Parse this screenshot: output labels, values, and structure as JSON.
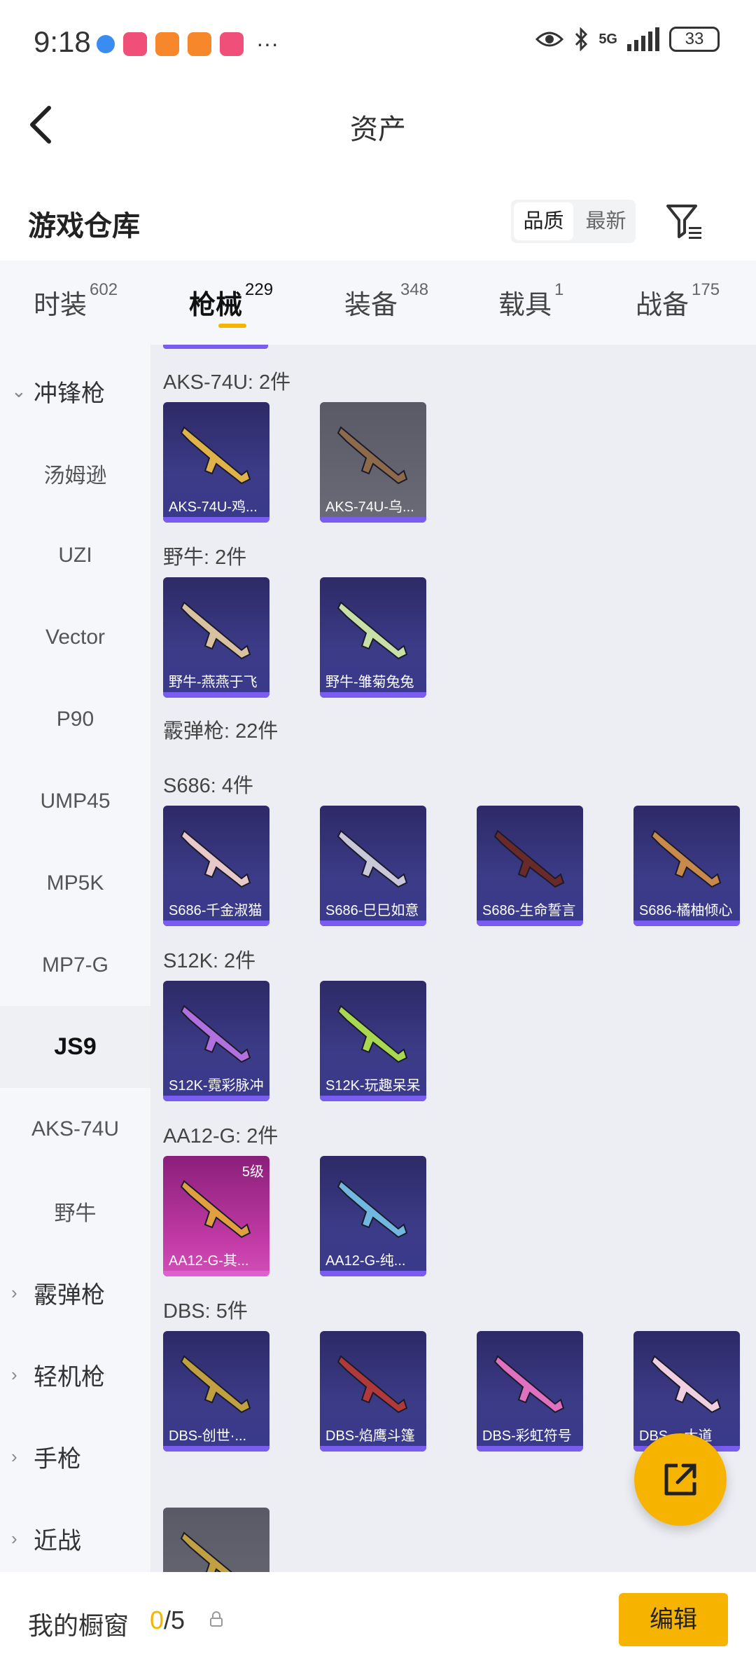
{
  "status_bar": {
    "time": "9:18",
    "network": "5G",
    "battery": "33"
  },
  "header": {
    "title": "资产"
  },
  "section": {
    "title": "游戏仓库",
    "sort_options": [
      "品质",
      "最新"
    ]
  },
  "tabs": [
    {
      "label": "时装",
      "count": "602"
    },
    {
      "label": "枪械",
      "count": "229"
    },
    {
      "label": "装备",
      "count": "348"
    },
    {
      "label": "载具",
      "count": "1"
    },
    {
      "label": "战备",
      "count": "175"
    }
  ],
  "sidebar": {
    "items": [
      {
        "label": "冲锋枪",
        "type": "group",
        "chevron": "⌄"
      },
      {
        "label": "汤姆逊",
        "type": "item"
      },
      {
        "label": "UZI",
        "type": "item"
      },
      {
        "label": "Vector",
        "type": "item"
      },
      {
        "label": "P90",
        "type": "item"
      },
      {
        "label": "UMP45",
        "type": "item"
      },
      {
        "label": "MP5K",
        "type": "item"
      },
      {
        "label": "MP7-G",
        "type": "item"
      },
      {
        "label": "JS9",
        "type": "item",
        "active": true
      },
      {
        "label": "AKS-74U",
        "type": "item"
      },
      {
        "label": "野牛",
        "type": "item"
      },
      {
        "label": "霰弹枪",
        "type": "group",
        "chevron": "›"
      },
      {
        "label": "轻机枪",
        "type": "group",
        "chevron": "›"
      },
      {
        "label": "手枪",
        "type": "group",
        "chevron": "›"
      },
      {
        "label": "近战",
        "type": "group",
        "chevron": "›"
      }
    ]
  },
  "content": {
    "groups": [
      {
        "label": "AKS-74U: 2件",
        "cards": [
          {
            "name": "AKS-74U-鸡...",
            "style": "blue"
          },
          {
            "name": "AKS-74U-乌...",
            "style": "gray"
          }
        ]
      },
      {
        "label": "野牛: 2件",
        "cards": [
          {
            "name": "野牛-燕燕于飞",
            "style": "blue"
          },
          {
            "name": "野牛-雏菊兔兔",
            "style": "blue"
          }
        ]
      },
      {
        "label": "霰弹枪: 22件",
        "cards": []
      },
      {
        "label": "S686: 4件",
        "cards": [
          {
            "name": "S686-千金淑猫",
            "style": "blue"
          },
          {
            "name": "S686-巳巳如意",
            "style": "blue"
          },
          {
            "name": "S686-生命誓言",
            "style": "blue"
          },
          {
            "name": "S686-橘柚倾心",
            "style": "blue"
          }
        ]
      },
      {
        "label": "S12K: 2件",
        "cards": [
          {
            "name": "S12K-霓彩脉冲",
            "style": "blue"
          },
          {
            "name": "S12K-玩趣呆呆",
            "style": "blue"
          }
        ]
      },
      {
        "label": "AA12-G: 2件",
        "cards": [
          {
            "name": "AA12-G-其...",
            "style": "pink",
            "level": "5级"
          },
          {
            "name": "AA12-G-纯...",
            "style": "blue"
          }
        ]
      },
      {
        "label": "DBS: 5件",
        "cards": [
          {
            "name": "DBS-创世·...",
            "style": "blue"
          },
          {
            "name": "DBS-焰鹰斗篷",
            "style": "blue"
          },
          {
            "name": "DBS-彩虹符号",
            "style": "blue"
          },
          {
            "name": "DBS-...大道",
            "style": "blue"
          },
          {
            "name": "",
            "style": "gray"
          }
        ]
      }
    ]
  },
  "bottom_bar": {
    "label": "我的橱窗",
    "used": "0",
    "total": "/5",
    "edit_label": "编辑"
  },
  "colors": {
    "accent": "#f6b400",
    "card_base": "#3c3b88",
    "card_bar": "#7a5cf0",
    "content_bg": "#eceef3",
    "sidebar_bg": "#f5f7fb"
  }
}
